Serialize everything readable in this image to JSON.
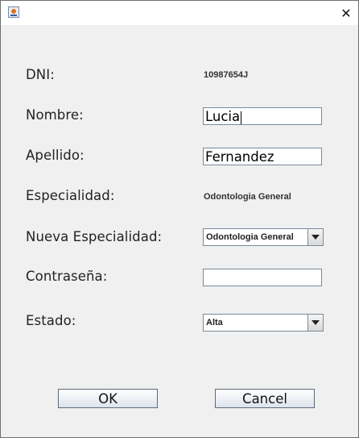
{
  "window": {
    "title": "",
    "close_glyph": "✕"
  },
  "form": {
    "dni_label": "DNI:",
    "dni_value": "10987654J",
    "nombre_label": "Nombre:",
    "nombre_value": "Lucia",
    "apellido_label": "Apellido:",
    "apellido_value": "Fernandez",
    "especialidad_label": "Especialidad:",
    "especialidad_value": "Odontologia General",
    "nueva_especialidad_label": "Nueva Especialidad:",
    "nueva_especialidad_selected": "Odontologia General",
    "contrasena_label": "Contraseña:",
    "contrasena_value": "",
    "estado_label": "Estado:",
    "estado_selected": "Alta"
  },
  "buttons": {
    "ok": "OK",
    "cancel": "Cancel"
  },
  "icons": {
    "app": "java-app-icon",
    "close": "close-icon",
    "dropdown": "chevron-down-icon"
  }
}
